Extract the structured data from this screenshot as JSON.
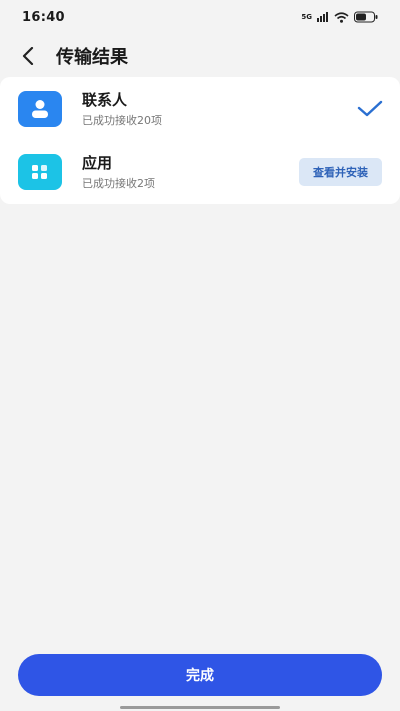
{
  "status_bar": {
    "time": "16:40",
    "network": "5G",
    "icons": [
      "signal-icon",
      "wifi-icon",
      "battery-icon"
    ]
  },
  "header": {
    "title": "传输结果",
    "back_icon": "back-arrow-icon"
  },
  "results": [
    {
      "icon": "contacts-icon",
      "title": "联系人",
      "subtitle": "已成功接收20项",
      "status": "check-icon"
    },
    {
      "icon": "apps-icon",
      "title": "应用",
      "subtitle": "已成功接收2项",
      "action_label": "查看并安装"
    }
  ],
  "footer": {
    "done_label": "完成"
  },
  "colors": {
    "accent": "#2f55e6",
    "check": "#2a6fd1",
    "contacts_icon_bg": "#2a86f0",
    "apps_icon_bg": "#1cc3e6",
    "secondary_button_bg": "#dbe7f6"
  }
}
